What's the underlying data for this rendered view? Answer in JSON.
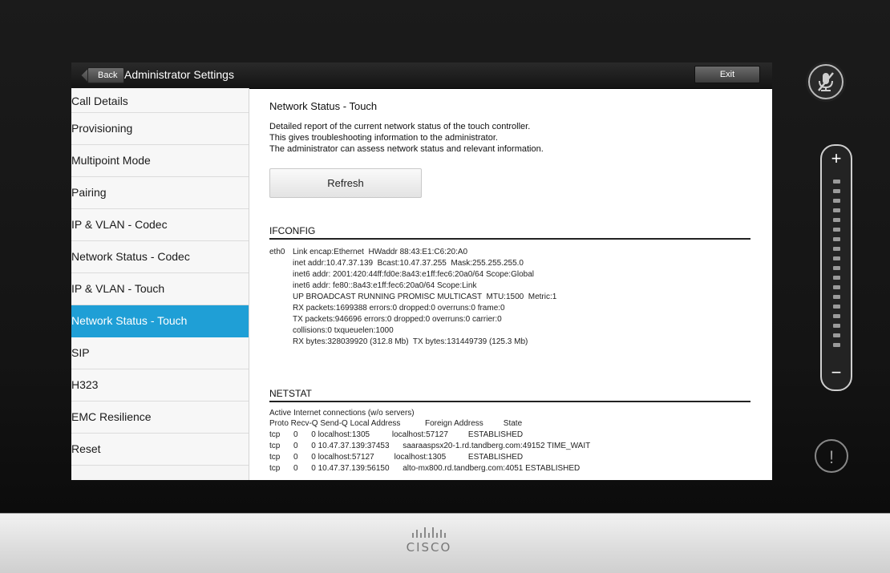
{
  "header": {
    "back_label": "Back",
    "title": "Administrator Settings",
    "exit_label": "Exit"
  },
  "sidebar": {
    "items": [
      {
        "label": "Call Details",
        "active": false
      },
      {
        "label": "Provisioning",
        "active": false
      },
      {
        "label": "Multipoint Mode",
        "active": false
      },
      {
        "label": "Pairing",
        "active": false
      },
      {
        "label": "IP & VLAN - Codec",
        "active": false
      },
      {
        "label": "Network Status - Codec",
        "active": false
      },
      {
        "label": "IP & VLAN - Touch",
        "active": false
      },
      {
        "label": "Network Status - Touch",
        "active": true
      },
      {
        "label": "SIP",
        "active": false
      },
      {
        "label": "H323",
        "active": false
      },
      {
        "label": "EMC Resilience",
        "active": false
      },
      {
        "label": "Reset",
        "active": false
      }
    ]
  },
  "main": {
    "title": "Network Status - Touch",
    "description": [
      "Detailed report of the current network status of the touch controller.",
      "This gives troubleshooting information to the administrator.",
      "The administrator can assess network status and relevant information."
    ],
    "refresh_label": "Refresh",
    "ifconfig": {
      "heading": "IFCONFIG",
      "iface": "eth0",
      "lines": [
        "Link encap:Ethernet  HWaddr 88:43:E1:C6:20:A0",
        "inet addr:10.47.37.139  Bcast:10.47.37.255  Mask:255.255.255.0",
        "inet6 addr: 2001:420:44ff:fd0e:8a43:e1ff:fec6:20a0/64 Scope:Global",
        "inet6 addr: fe80::8a43:e1ff:fec6:20a0/64 Scope:Link",
        "UP BROADCAST RUNNING PROMISC MULTICAST  MTU:1500  Metric:1",
        "RX packets:1699388 errors:0 dropped:0 overruns:0 frame:0",
        "TX packets:946696 errors:0 dropped:0 overruns:0 carrier:0",
        "collisions:0 txqueuelen:1000",
        "RX bytes:328039920 (312.8 Mb)  TX bytes:131449739 (125.3 Mb)"
      ]
    },
    "netstat": {
      "heading": "NETSTAT",
      "lines": [
        "Active Internet connections (w/o servers)",
        "Proto Recv-Q Send-Q Local Address           Foreign Address         State",
        "tcp      0      0 localhost:1305          localhost:57127         ESTABLISHED",
        "tcp      0      0 10.47.37.139:37453      saaraaspsx20-1.rd.tandberg.com:49152 TIME_WAIT",
        "tcp      0      0 localhost:57127         localhost:1305          ESTABLISHED",
        "tcp      0      0 10.47.37.139:56150      alto-mx800.rd.tandberg.com:4051 ESTABLISHED"
      ]
    }
  },
  "controls": {
    "volume_plus": "+",
    "volume_minus": "−",
    "alert_symbol": "!",
    "mic_icon": "mic-muted-icon"
  },
  "footer": {
    "brand": "CISCO"
  },
  "colors": {
    "accent": "#1f9fd6",
    "topbar": "#1c1c1c"
  }
}
